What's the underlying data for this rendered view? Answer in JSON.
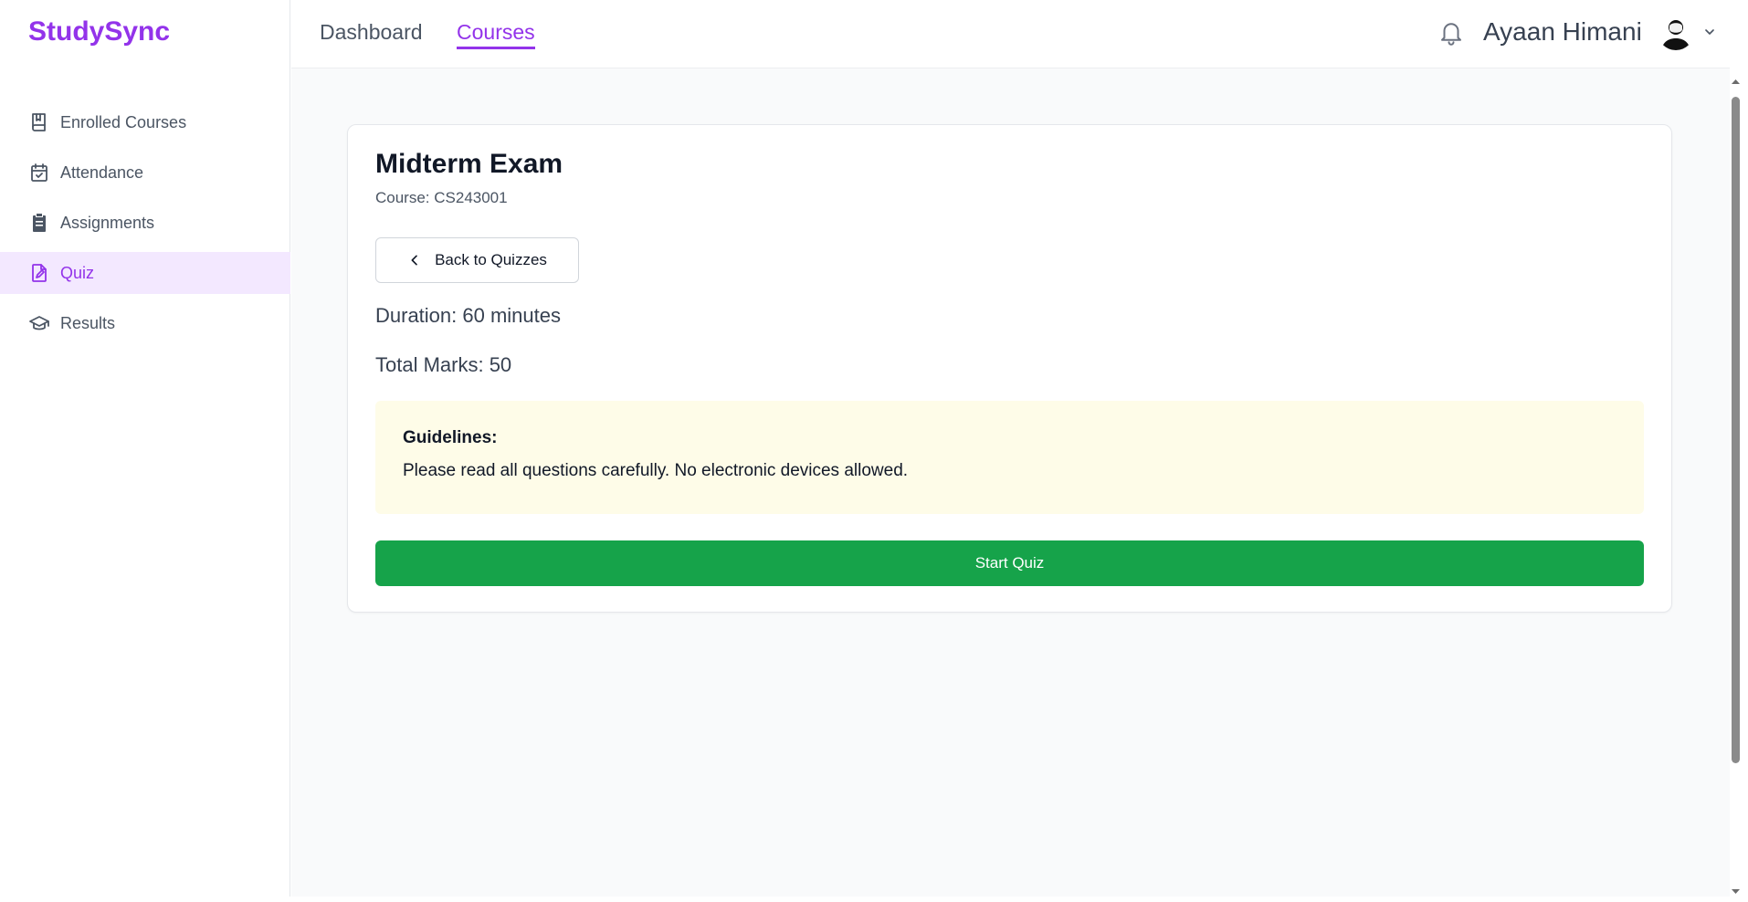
{
  "brand": "StudySync",
  "sidebar": {
    "items": [
      {
        "label": "Enrolled Courses",
        "icon": "book-icon"
      },
      {
        "label": "Attendance",
        "icon": "calendar-check-icon"
      },
      {
        "label": "Assignments",
        "icon": "clipboard-icon"
      },
      {
        "label": "Quiz",
        "icon": "file-edit-icon",
        "active": true
      },
      {
        "label": "Results",
        "icon": "graduation-cap-icon"
      }
    ]
  },
  "header": {
    "tabs": [
      {
        "label": "Dashboard",
        "active": false
      },
      {
        "label": "Courses",
        "active": true
      }
    ],
    "user_name": "Ayaan Himani"
  },
  "quiz": {
    "title": "Midterm Exam",
    "course": "Course: CS243001",
    "back_label": "Back to Quizzes",
    "duration": "Duration: 60 minutes",
    "total_marks": "Total Marks: 50",
    "guidelines_title": "Guidelines:",
    "guidelines_text": "Please read all questions carefully. No electronic devices allowed.",
    "start_label": "Start Quiz"
  },
  "colors": {
    "accent": "#9333ea",
    "accent_bg": "#f3e8ff",
    "start_button": "#16a34a",
    "guidelines_bg": "#fefce8"
  }
}
